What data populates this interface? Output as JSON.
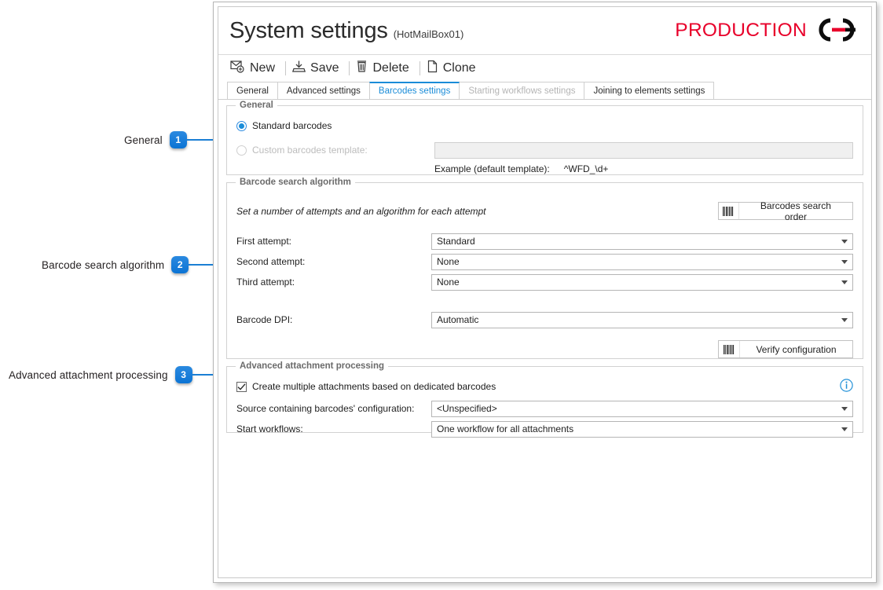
{
  "window": {
    "header": {
      "title": "System settings",
      "subtitle": "(HotMailBox01)",
      "brand_text": "PRODUCTION",
      "brand_color": "#e8002a",
      "logo_icon": "chain-link-logo"
    },
    "toolbar": {
      "items": [
        {
          "label": "New",
          "icon": "new-mail-icon"
        },
        {
          "label": "Save",
          "icon": "save-icon"
        },
        {
          "label": "Delete",
          "icon": "trash-icon"
        },
        {
          "label": "Clone",
          "icon": "document-copy-icon"
        }
      ]
    },
    "tabs": [
      {
        "label": "General",
        "state": "normal"
      },
      {
        "label": "Advanced settings",
        "state": "normal"
      },
      {
        "label": "Barcodes settings",
        "state": "active"
      },
      {
        "label": "Starting workflows settings",
        "state": "disabled"
      },
      {
        "label": "Joining to elements settings",
        "state": "normal"
      }
    ]
  },
  "general_group": {
    "legend": "General",
    "standard_radio_label": "Standard barcodes",
    "standard_radio_selected": true,
    "custom_radio_label": "Custom barcodes template:",
    "custom_radio_selected": false,
    "custom_template_value": "",
    "example_label": "Example (default template):",
    "example_value": "^WFD_\\d+"
  },
  "search_group": {
    "legend": "Barcode search algorithm",
    "hint": "Set a number of attempts and an algorithm for each attempt",
    "order_button_label": "Barcodes search order",
    "order_button_icon": "barcode-icon",
    "verify_button_label": "Verify configuration",
    "verify_button_icon": "barcode-icon",
    "fields": [
      {
        "label": "First attempt:",
        "value": "Standard"
      },
      {
        "label": "Second attempt:",
        "value": "None"
      },
      {
        "label": "Third attempt:",
        "value": "None"
      }
    ],
    "dpi_field": {
      "label": "Barcode DPI:",
      "value": "Automatic"
    }
  },
  "advanced_group": {
    "legend": "Advanced attachment processing",
    "checkbox_label": "Create multiple attachments based on dedicated barcodes",
    "checkbox_checked": true,
    "info_icon": "info-icon",
    "fields": [
      {
        "label": "Source containing barcodes' configuration:",
        "value": "<Unspecified>"
      },
      {
        "label": "Start workflows:",
        "value": "One workflow for all attachments"
      }
    ]
  },
  "callouts": [
    {
      "number": "1",
      "label": "General"
    },
    {
      "number": "2",
      "label": "Barcode search algorithm"
    },
    {
      "number": "3",
      "label": "Advanced attachment processing"
    }
  ],
  "accent_color": "#1a8cd8"
}
